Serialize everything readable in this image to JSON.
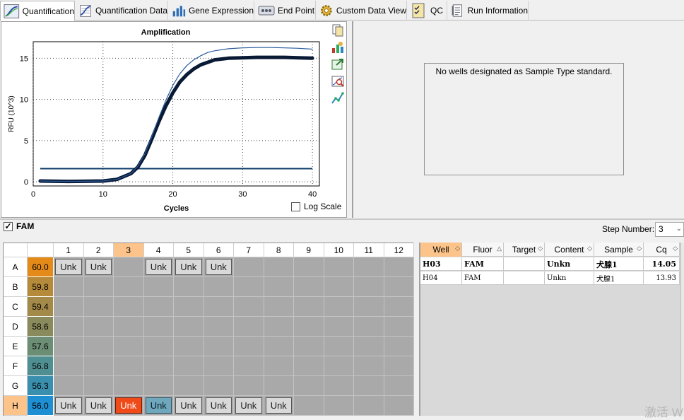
{
  "tabs": [
    {
      "label": "Quantification",
      "icon": "amplification-curve-icon",
      "active": true
    },
    {
      "label": "Quantification Data",
      "icon": "data-table-curve-icon",
      "active": false
    },
    {
      "label": "Gene Expression",
      "icon": "bar-chart-icon",
      "active": false
    },
    {
      "label": "End Point",
      "icon": "end-point-icon",
      "active": false
    },
    {
      "label": "Custom Data View",
      "icon": "gear-icon",
      "active": false
    },
    {
      "label": "QC",
      "icon": "checklist-icon",
      "active": false
    },
    {
      "label": "Run Information",
      "icon": "document-icon",
      "active": false
    }
  ],
  "chart_data": {
    "type": "line",
    "title": "Amplification",
    "xlabel": "Cycles",
    "ylabel": "RFU (10^3)",
    "xlim": [
      0,
      41
    ],
    "ylim": [
      -0.5,
      17
    ],
    "x_ticks": [
      "0",
      "10",
      "20",
      "30",
      "40"
    ],
    "y_ticks": [
      "0",
      "5",
      "10",
      "15"
    ],
    "grid": true,
    "threshold": 1.6,
    "series": [
      {
        "x": [
          1,
          5,
          10,
          12,
          14,
          15,
          16,
          17,
          18,
          19,
          20,
          21,
          22,
          23,
          24,
          25,
          26,
          28,
          30,
          32,
          34,
          36,
          38,
          40
        ],
        "y": [
          0.1,
          0.05,
          0.1,
          0.3,
          1.0,
          1.8,
          3.2,
          5.2,
          7.3,
          9.2,
          10.8,
          12.1,
          13.0,
          13.7,
          14.2,
          14.5,
          14.8,
          15.0,
          15.05,
          15.1,
          15.1,
          15.1,
          15.05,
          15.0
        ],
        "color": "#0a1a35",
        "width": 5
      },
      {
        "x": [
          1,
          5,
          10,
          12,
          14,
          15,
          16,
          17,
          18,
          19,
          20,
          21,
          22,
          23,
          24,
          25,
          26,
          28,
          30,
          32,
          34,
          36,
          38,
          40
        ],
        "y": [
          0.1,
          0.05,
          0.1,
          0.3,
          1.0,
          1.9,
          3.4,
          5.5,
          7.8,
          9.9,
          11.7,
          13.1,
          14.1,
          14.8,
          15.3,
          15.7,
          15.9,
          16.15,
          16.25,
          16.3,
          16.3,
          16.25,
          16.2,
          16.1
        ],
        "color": "#2a5a9a",
        "width": 1.2
      }
    ]
  },
  "logscale": {
    "label": "Log Scale",
    "checked": false
  },
  "side_tools": [
    "copy-icon",
    "chart-settings-icon",
    "export-icon",
    "zoom-icon",
    "trace-icon"
  ],
  "standard": {
    "message": "No wells designated as Sample Type standard."
  },
  "fluor": {
    "label": "FAM",
    "checked": true
  },
  "step": {
    "label": "Step Number:",
    "value": "3"
  },
  "plate": {
    "columns": [
      "1",
      "2",
      "3",
      "4",
      "5",
      "6",
      "7",
      "8",
      "9",
      "10",
      "11",
      "12"
    ],
    "selected_column": "3",
    "rows": [
      {
        "label": "A",
        "temp": "60.0",
        "temp_color": "#e38a19",
        "selected": false,
        "wells": [
          "Unk",
          "Unk",
          "",
          "Unk",
          "Unk",
          "Unk",
          "",
          "",
          "",
          "",
          "",
          ""
        ],
        "states": [
          "n",
          "n",
          "",
          "n",
          "n",
          "n",
          "",
          "",
          "",
          "",
          "",
          ""
        ]
      },
      {
        "label": "B",
        "temp": "59.8",
        "temp_color": "#b58a3a",
        "selected": false,
        "wells": [
          "",
          "",
          "",
          "",
          "",
          "",
          "",
          "",
          "",
          "",
          "",
          ""
        ],
        "states": [
          "",
          "",
          "",
          "",
          "",
          "",
          "",
          "",
          "",
          "",
          "",
          ""
        ]
      },
      {
        "label": "C",
        "temp": "59.4",
        "temp_color": "#a48a48",
        "selected": false,
        "wells": [
          "",
          "",
          "",
          "",
          "",
          "",
          "",
          "",
          "",
          "",
          "",
          ""
        ],
        "states": [
          "",
          "",
          "",
          "",
          "",
          "",
          "",
          "",
          "",
          "",
          "",
          ""
        ]
      },
      {
        "label": "D",
        "temp": "58.6",
        "temp_color": "#8a8b5c",
        "selected": false,
        "wells": [
          "",
          "",
          "",
          "",
          "",
          "",
          "",
          "",
          "",
          "",
          "",
          ""
        ],
        "states": [
          "",
          "",
          "",
          "",
          "",
          "",
          "",
          "",
          "",
          "",
          "",
          ""
        ]
      },
      {
        "label": "E",
        "temp": "57.6",
        "temp_color": "#6c8e75",
        "selected": false,
        "wells": [
          "",
          "",
          "",
          "",
          "",
          "",
          "",
          "",
          "",
          "",
          "",
          ""
        ],
        "states": [
          "",
          "",
          "",
          "",
          "",
          "",
          "",
          "",
          "",
          "",
          "",
          ""
        ]
      },
      {
        "label": "F",
        "temp": "56.8",
        "temp_color": "#4f8f92",
        "selected": false,
        "wells": [
          "",
          "",
          "",
          "",
          "",
          "",
          "",
          "",
          "",
          "",
          "",
          ""
        ],
        "states": [
          "",
          "",
          "",
          "",
          "",
          "",
          "",
          "",
          "",
          "",
          "",
          ""
        ]
      },
      {
        "label": "G",
        "temp": "56.3",
        "temp_color": "#3a8fae",
        "selected": false,
        "wells": [
          "",
          "",
          "",
          "",
          "",
          "",
          "",
          "",
          "",
          "",
          "",
          ""
        ],
        "states": [
          "",
          "",
          "",
          "",
          "",
          "",
          "",
          "",
          "",
          "",
          "",
          ""
        ]
      },
      {
        "label": "H",
        "temp": "56.0",
        "temp_color": "#1f8fd4",
        "selected": true,
        "wells": [
          "Unk",
          "Unk",
          "Unk",
          "Unk",
          "Unk",
          "Unk",
          "Unk",
          "Unk",
          "",
          "",
          "",
          ""
        ],
        "states": [
          "n",
          "n",
          "red",
          "teal",
          "n",
          "n",
          "n",
          "n",
          "",
          "",
          "",
          ""
        ]
      }
    ]
  },
  "well_table": {
    "columns": [
      {
        "label": "Well",
        "sort": "◇",
        "highlight": true
      },
      {
        "label": "Fluor",
        "sort": "△",
        "highlight": false
      },
      {
        "label": "Target",
        "sort": "◇",
        "highlight": false
      },
      {
        "label": "Content",
        "sort": "◇",
        "highlight": false
      },
      {
        "label": "Sample",
        "sort": "◇",
        "highlight": false
      },
      {
        "label": "Cq",
        "sort": "◇",
        "highlight": false
      }
    ],
    "rows": [
      {
        "cells": [
          "H03",
          "FAM",
          "",
          "Unkn",
          "犬腺1",
          "14.05"
        ],
        "bold": true
      },
      {
        "cells": [
          "H04",
          "FAM",
          "",
          "Unkn",
          "犬腺1",
          "13.93"
        ],
        "bold": false
      }
    ]
  },
  "watermark": "激活 W"
}
